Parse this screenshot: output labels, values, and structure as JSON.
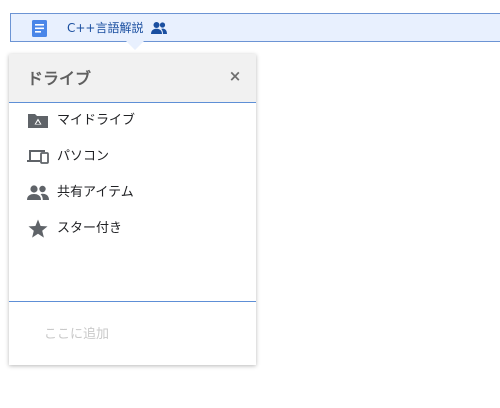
{
  "topbar": {
    "doc_icon": "document-icon",
    "doc_title": "C++言語解説",
    "shared_icon": "people-icon"
  },
  "panel": {
    "title": "ドライブ",
    "close_label": "×",
    "items": [
      {
        "label": "マイドライブ",
        "icon": "my-drive-folder-icon"
      },
      {
        "label": "パソコン",
        "icon": "computers-icon"
      },
      {
        "label": "共有アイテム",
        "icon": "shared-people-icon"
      },
      {
        "label": "スター付き",
        "icon": "star-icon"
      }
    ],
    "add_here": "ここに追加"
  },
  "colors": {
    "topbar_bg": "#e8f0fe",
    "accent_blue": "#5e8fd6",
    "icon_gray": "#5f6368",
    "doc_blue": "#4a86e8"
  }
}
